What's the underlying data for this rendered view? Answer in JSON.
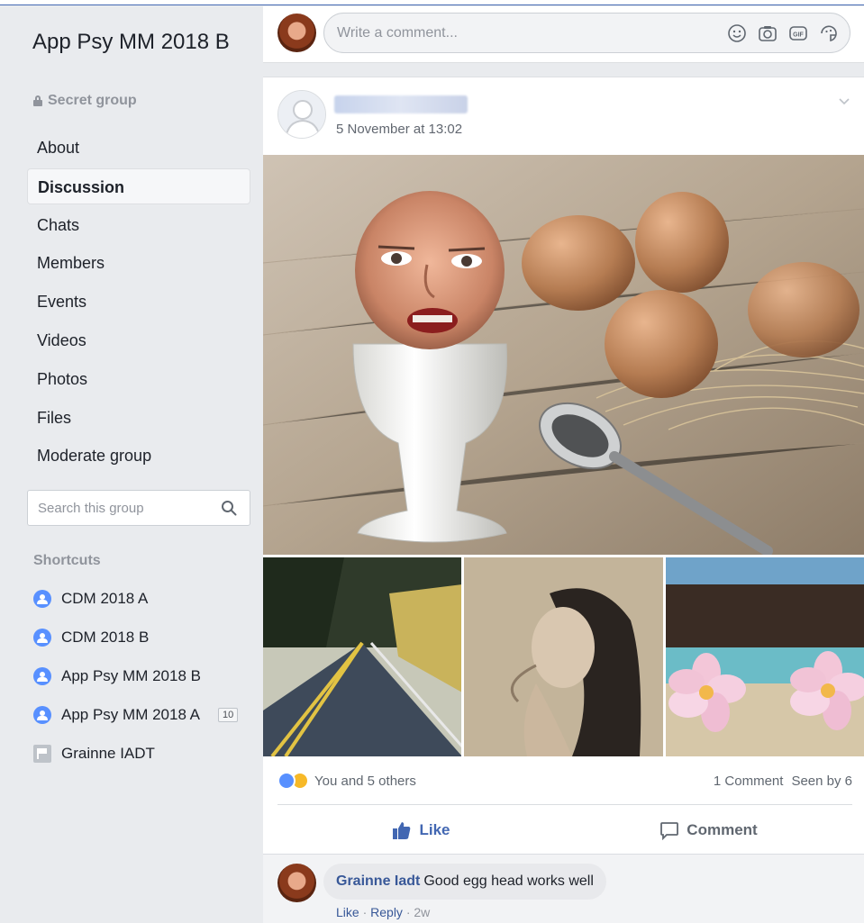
{
  "group": {
    "title": "App Psy MM 2018 B",
    "privacy": "Secret group"
  },
  "nav": {
    "items": [
      {
        "label": "About"
      },
      {
        "label": "Discussion",
        "active": true
      },
      {
        "label": "Chats"
      },
      {
        "label": "Members"
      },
      {
        "label": "Events"
      },
      {
        "label": "Videos"
      },
      {
        "label": "Photos"
      },
      {
        "label": "Files"
      },
      {
        "label": "Moderate group"
      }
    ]
  },
  "search": {
    "placeholder": "Search this group"
  },
  "shortcuts": {
    "title": "Shortcuts",
    "items": [
      {
        "label": "CDM 2018 A",
        "icon": "group-icon"
      },
      {
        "label": "CDM 2018 B",
        "icon": "group-icon"
      },
      {
        "label": "App Psy MM 2018 B",
        "icon": "group-icon"
      },
      {
        "label": "App Psy MM 2018 A",
        "icon": "group-icon",
        "badge": "10"
      },
      {
        "label": "Grainne IADT",
        "icon": "page-flag-icon"
      }
    ]
  },
  "composer": {
    "placeholder": "Write a comment..."
  },
  "post": {
    "author": "",
    "timestamp": "5 November at 13:02",
    "reactions": {
      "summary": "You and 5 others",
      "comments_count": "1 Comment",
      "seen_by": "Seen by 6"
    },
    "actions": {
      "like": "Like",
      "comment": "Comment"
    }
  },
  "comment": {
    "author": "Grainne Iadt",
    "text": "Good egg head works well",
    "like": "Like",
    "reply": "Reply",
    "age": "2w",
    "separator": "·"
  },
  "colors": {
    "brand_blue": "#4267b2",
    "link": "#385898",
    "background": "#e9ebee",
    "muted_text": "#90949c"
  }
}
